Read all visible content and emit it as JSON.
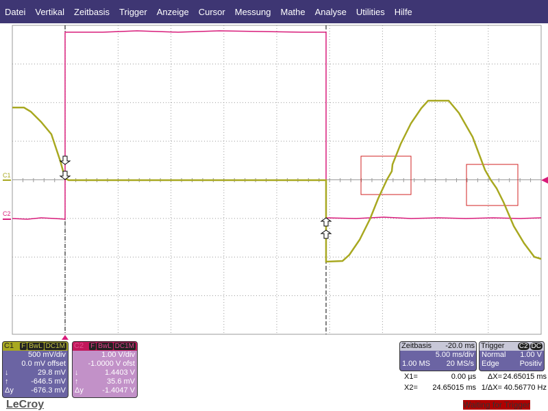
{
  "menu": [
    "Datei",
    "Vertikal",
    "Zeitbasis",
    "Trigger",
    "Anzeige",
    "Cursor",
    "Messung",
    "Mathe",
    "Analyse",
    "Utilities",
    "Hilfe"
  ],
  "colors": {
    "c1": "#a8a820",
    "c2": "#d81b7a",
    "menubar": "#3e3673",
    "panel": "#6b64a3",
    "roi": "#d02020"
  },
  "trace_labels": {
    "c1": "C1",
    "c2": "C2"
  },
  "c1": {
    "name": "C1",
    "flags": [
      "F",
      "BwL",
      "DC1M"
    ],
    "vdiv": "500 mV/div",
    "offset": "0.0 mV offset",
    "down_label": "↓",
    "down": "29.8 mV",
    "up_label": "↑",
    "up": "-646.5 mV",
    "dy_label": "Δy",
    "dy": "-676.3 mV"
  },
  "c2": {
    "name": "C2",
    "flags": [
      "F",
      "BwL",
      "DC1M"
    ],
    "vdiv": "1.00 V/div",
    "offset": "-1.0000 V ofst",
    "down_label": "↓",
    "down": "1.4403 V",
    "up_label": "↑",
    "up": "35.6 mV",
    "dy_label": "Δy",
    "dy": "-1.4047 V"
  },
  "timebase": {
    "title": "Zeitbasis",
    "delay": "-20.0 ms",
    "tdiv": "5.00 ms/div",
    "samples": "1.00 MS",
    "rate": "20 MS/s"
  },
  "trigger": {
    "title": "Trigger",
    "source": "C2",
    "coupling": "DC",
    "mode": "Normal",
    "level": "1.00 V",
    "type": "Edge",
    "slope": "Positiv"
  },
  "cursors": {
    "x1_label": "X1=",
    "x1": "0.00 µs",
    "dx_label": "ΔX=",
    "dx": "24.65015 ms",
    "x2_label": "X2=",
    "x2": "24.65015 ms",
    "inv_label": "1/ΔX=",
    "inv": "40.56770 Hz"
  },
  "logo": "LeCroy",
  "status": {
    "highlighted": "Waiting for Tri",
    "rest": "gger"
  }
}
